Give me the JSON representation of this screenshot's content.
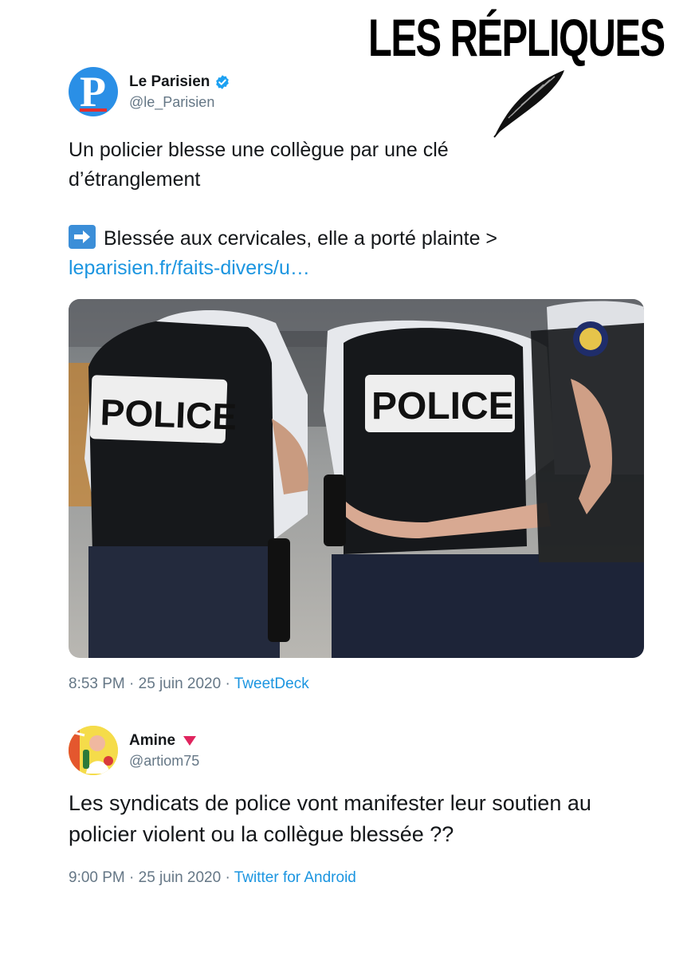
{
  "brand": {
    "title": "LES RÉPLIQUES"
  },
  "tweet1": {
    "author_name": "Le Parisien",
    "author_handle": "@le_Parisien",
    "text_line1": "Un policier blesse une collègue par une clé",
    "text_line2": "d’étranglement",
    "text_line3": "Blessée aux cervicales, elle a porté plainte >",
    "link": "leparisien.fr/faits-divers/u…",
    "vest_label_left": "POLICE",
    "vest_label_right": "POLICE",
    "time": "8:53 PM · 25 juin 2020 · ",
    "source": "TweetDeck"
  },
  "tweet2": {
    "author_name": "Amine",
    "author_handle": "@artiom75",
    "text": "Les syndicats de police vont manifester leur soutien au policier violent ou la collègue blessée ??",
    "time": "9:00 PM · 25 juin 2020 · ",
    "source": "Twitter for Android"
  },
  "colors": {
    "link": "#1b95e0",
    "secondary": "#657786",
    "verified": "#1da1f2",
    "accent": "#e0245e"
  }
}
